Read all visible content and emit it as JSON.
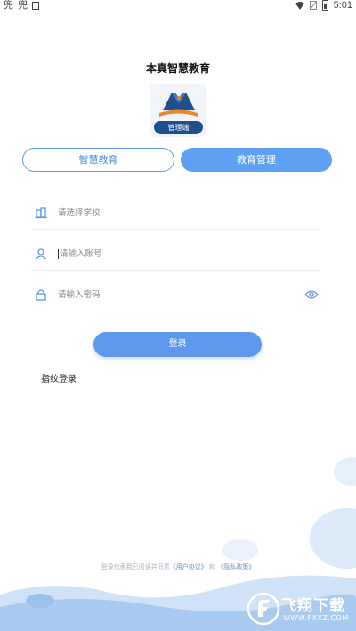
{
  "status_bar": {
    "left_glyphs": [
      "兜",
      "兜"
    ],
    "time": "5:01"
  },
  "app": {
    "title": "本真智慧教育",
    "logo_badge": "管理端"
  },
  "tabs": [
    {
      "label": "智慧教育",
      "selected": false
    },
    {
      "label": "教育管理",
      "selected": true
    }
  ],
  "form": {
    "school_placeholder": "请选择学校",
    "account_placeholder": "请输入账号",
    "password_placeholder": "请输入密码"
  },
  "login_button": "登录",
  "fingerprint_login": "指纹登录",
  "agreement": {
    "prefix": "登录代表我已阅读并同意",
    "user_agreement": "《用户协议》",
    "and": "和",
    "privacy_policy": "《隐私政策》"
  },
  "watermark": {
    "text": "飞翔下载",
    "url": "WWW.FXXZ.COM"
  },
  "colors": {
    "accent": "#5ea1f2",
    "button": "#5e98ec",
    "wave_light": "#e3eefb",
    "wave_mid": "#bcd6f4"
  },
  "icons": {
    "school": "building-icon",
    "account": "user-icon",
    "password": "lock-icon",
    "visibility": "eye-icon"
  }
}
